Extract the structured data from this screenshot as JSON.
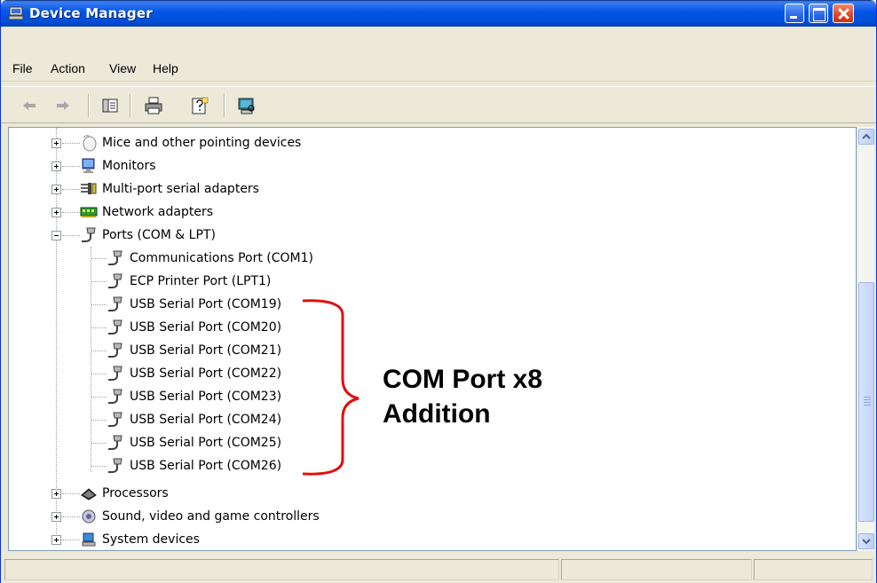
{
  "window": {
    "title": "Device Manager"
  },
  "menu": {
    "items": [
      "File",
      "Action",
      "View",
      "Help"
    ]
  },
  "toolbar": {
    "buttons": [
      "back-arrow-icon",
      "forward-arrow-icon",
      "properties-icon",
      "print-icon",
      "help-icon",
      "scan-hardware-icon"
    ]
  },
  "tree": {
    "nodes": [
      {
        "label": "Mice and other pointing devices",
        "icon": "mouse-icon",
        "expanded": false
      },
      {
        "label": "Monitors",
        "icon": "monitor-icon",
        "expanded": false
      },
      {
        "label": "Multi-port serial adapters",
        "icon": "serial-adapter-icon",
        "expanded": false
      },
      {
        "label": "Network adapters",
        "icon": "network-card-icon",
        "expanded": false
      },
      {
        "label": "Ports (COM & LPT)",
        "icon": "port-connector-icon",
        "expanded": true
      },
      {
        "label": "Processors",
        "icon": "processor-icon",
        "expanded": false
      },
      {
        "label": "Sound, video and game controllers",
        "icon": "speaker-icon",
        "expanded": false
      },
      {
        "label": "System devices",
        "icon": "system-device-icon",
        "expanded": false
      }
    ],
    "ports_children": [
      "Communications Port (COM1)",
      "ECP Printer Port (LPT1)",
      "USB Serial Port (COM19)",
      "USB Serial Port (COM20)",
      "USB Serial Port (COM21)",
      "USB Serial Port (COM22)",
      "USB Serial Port (COM23)",
      "USB Serial Port (COM24)",
      "USB Serial Port (COM25)",
      "USB Serial Port (COM26)"
    ]
  },
  "annotation": {
    "line1": "COM Port x8",
    "line2": "Addition",
    "color": "#e01010"
  },
  "colors": {
    "titlebar": "#0055e5",
    "chrome": "#ece9d8",
    "close_button": "#e0492a"
  }
}
